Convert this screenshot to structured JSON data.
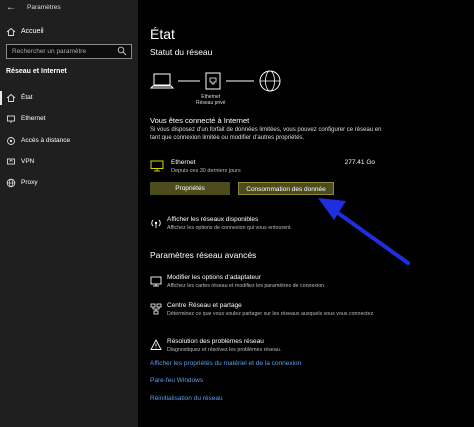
{
  "app": {
    "title": "Paramètres"
  },
  "sidebar": {
    "home_label": "Accueil",
    "search_placeholder": "Rechercher un paramètre",
    "section_title": "Réseau et Internet",
    "items": [
      {
        "label": "État",
        "icon": "home-icon",
        "active": true
      },
      {
        "label": "Ethernet",
        "icon": "ethernet-icon",
        "active": false
      },
      {
        "label": "Accès à distance",
        "icon": "dialup-icon",
        "active": false
      },
      {
        "label": "VPN",
        "icon": "vpn-icon",
        "active": false
      },
      {
        "label": "Proxy",
        "icon": "globe-icon",
        "active": false
      }
    ]
  },
  "main": {
    "title": "État",
    "network_status_title": "Statut du réseau",
    "network_name": "Ethernet",
    "network_type": "Réseau privé",
    "connected_heading": "Vous êtes connecté à Internet",
    "connected_desc": "Si vous disposez d’un forfait de données limitées, vous pouvez configurer ce réseau en tant que connexion limitée ou modifier d’autres propriétés.",
    "ethernet": {
      "name": "Ethernet",
      "subtitle": "Depuis ces 30 derniers jours",
      "usage": "277.41 Go"
    },
    "buttons": {
      "properties": "Propriétés",
      "data_usage": "Consommation des donnée"
    },
    "available_networks": {
      "title": "Afficher les réseaux disponibles",
      "desc": "Affichez les options de connexion qui vous entourent."
    },
    "advanced_title": "Paramètres réseau avancés",
    "advanced_items": [
      {
        "title": "Modifier les options d’adaptateur",
        "desc": "Affichez les cartes réseau et modifiez les paramètres de connexion."
      },
      {
        "title": "Centre Réseau et partage",
        "desc": "Déterminez ce que vous voulez partager sur les réseaux auxquels vous vous connectez."
      },
      {
        "title": "Résolution des problèmes réseau",
        "desc": "Diagnostiquez et résolvez les problèmes réseau."
      }
    ],
    "links": [
      "Afficher les propriétés du matériel et de la connexion",
      "Pare-feu Windows",
      "Réinitialisation du réseau"
    ]
  },
  "colors": {
    "accent_button": "#4c4c1c",
    "link": "#5e9ee5",
    "annotation_arrow": "#1f2fe0"
  }
}
